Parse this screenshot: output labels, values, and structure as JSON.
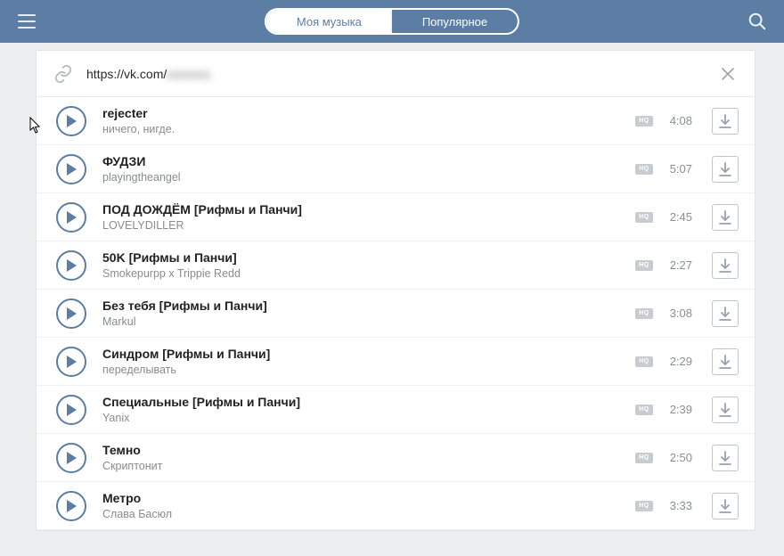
{
  "tabs": {
    "my_music": "Моя музыка",
    "popular": "Популярное"
  },
  "urlbar": {
    "prefix": "https://vk.com/",
    "suffix_hidden": "xxxxxxx"
  },
  "hq_label": "HQ",
  "tracks": [
    {
      "title": "rejecter",
      "artist": "ничего, нигде.",
      "duration": "4:08"
    },
    {
      "title": "ФУДЗИ",
      "artist": "playingtheangel",
      "duration": "5:07"
    },
    {
      "title": "ПОД ДОЖДЁМ [Рифмы и Панчи]",
      "artist": "LOVELYDILLER",
      "duration": "2:45"
    },
    {
      "title": "50K [Рифмы и Панчи]",
      "artist": "Smokepurpp x Trippie Redd",
      "duration": "2:27"
    },
    {
      "title": "Без тебя [Рифмы и Панчи]",
      "artist": "Markul",
      "duration": "3:08"
    },
    {
      "title": "Синдром [Рифмы и Панчи]",
      "artist": "переделывать",
      "duration": "2:29"
    },
    {
      "title": "Специальные [Рифмы и Панчи]",
      "artist": "Yanix",
      "duration": "2:39"
    },
    {
      "title": "Темно",
      "artist": "Скриптонит",
      "duration": "2:50"
    },
    {
      "title": "Метро",
      "artist": "Слава Басюл",
      "duration": "3:33"
    }
  ]
}
